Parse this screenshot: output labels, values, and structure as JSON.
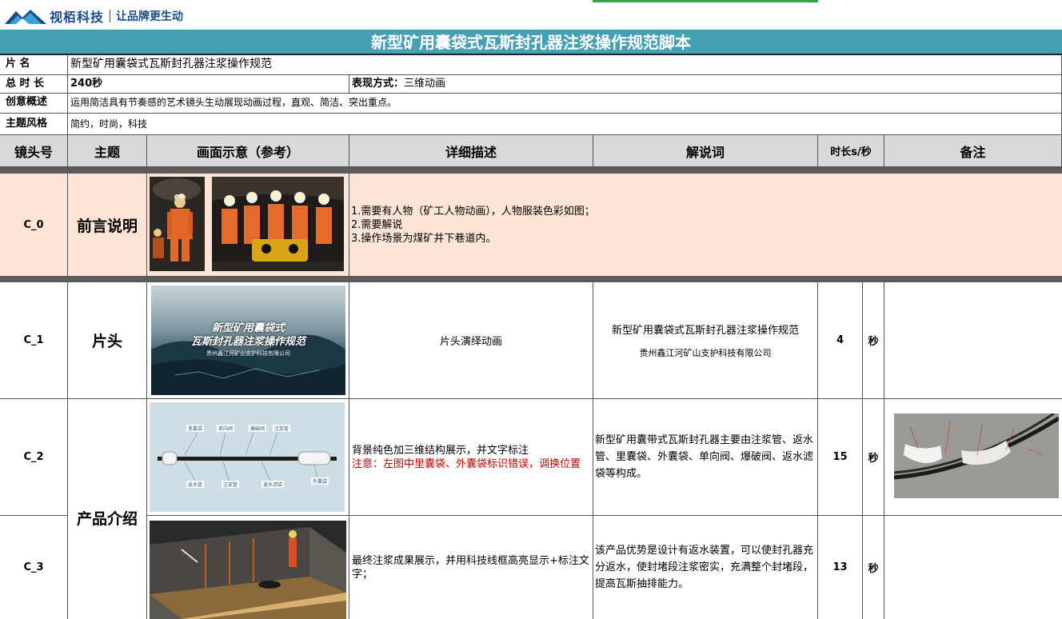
{
  "brand": {
    "logo_name": "视栢科技",
    "slogan": "让品牌更生动"
  },
  "document_title": "新型矿用囊袋式瓦斯封孔器注浆操作规范脚本",
  "meta": {
    "name_label": "片    名",
    "name_value": "新型矿用囊袋式瓦斯封孔器注浆操作规范",
    "duration_label": "总 时 长",
    "duration_value": "240秒",
    "mode_label": "表现方式：",
    "mode_value": "三维动画",
    "concept_label": "创意概述",
    "concept_value": "运用简洁具有节奏感的艺术镜头生动展现动画过程，直观、简洁、突出重点。",
    "style_label": "主题风格",
    "style_value": "简约，时尚，科技"
  },
  "columns": [
    "镜头号",
    "主题",
    "画面示意（参考）",
    "详细描述",
    "解说词",
    "时长s/秒",
    "备注"
  ],
  "rows": [
    {
      "id": "C_0",
      "topic": "前言说明",
      "desc_lines": [
        "1.需要有人物（矿工人物动画），人物服装色彩如图；",
        "2.需要解说",
        "3.操作场景为煤矿井下巷道内。"
      ]
    },
    {
      "id": "C_1",
      "topic": "片头",
      "image_text": {
        "line1": "新型矿用囊袋式",
        "line2": "瓦斯封孔器注浆操作规范",
        "line3": "贵州鑫江河矿山支护科技有限公司"
      },
      "desc": "片头演绎动画",
      "narration_line1": "新型矿用囊袋式瓦斯封孔器注浆操作规范",
      "narration_line2": "贵州鑫江河矿山支护科技有限公司",
      "duration": "4",
      "unit": "秒"
    },
    {
      "id": "C_2",
      "topic": "产品介绍",
      "image_labels": [
        "里囊袋",
        "单向阀",
        "爆破阀",
        "注浆管",
        "返水管",
        "注浆管",
        "返水滤袋",
        "外囊袋"
      ],
      "desc": "背景纯色加三维结构展示，并文字标注",
      "desc_note": "注意：左图中里囊袋、外囊袋标识错误，调换位置",
      "narration": "新型矿用囊带式瓦斯封孔器主要由注浆管、返水管、里囊袋、外囊袋、单向阀、爆破阀、返水滤袋等构成。",
      "duration": "15",
      "unit": "秒"
    },
    {
      "id": "C_3",
      "desc": "最终注浆成果展示，并用科技线框高亮显示+标注文字；",
      "narration": "该产品优势是设计有返水装置，可以使封孔器充分返水，使封堵段注浆密实，充满整个封堵段，提高瓦斯抽排能力。",
      "duration": "13",
      "unit": "秒"
    }
  ],
  "colors": {
    "title_bar": "#46a0b4",
    "header_bg": "#d9d9d9",
    "preface_bg": "#fce4d6",
    "separator": "#5b5b5b",
    "note_red": "#c00000"
  }
}
